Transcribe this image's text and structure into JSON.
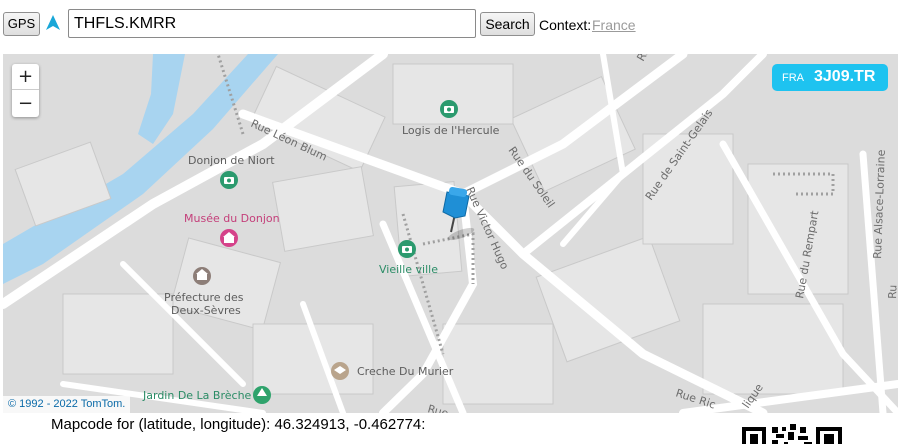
{
  "toolbar": {
    "gps_label": "GPS",
    "search_value": "THFLS.KMRR",
    "search_label": "Search",
    "context_label": "Context:",
    "context_value": "France"
  },
  "map": {
    "zoom_in": "+",
    "zoom_out": "−",
    "badge": {
      "context": "FRA",
      "code": "3J09.TR"
    },
    "copyright": "© 1992 - 2022 TomTom.",
    "streets": {
      "leon_blum": "Rue Léon Blum",
      "victor_hugo": "Rue Victor Hugo",
      "soleil": "Rue du Soleil",
      "saint_gelais": "Rue de Saint-Gelais",
      "rempart": "Rue du Rempart",
      "alsace_lorraine": "Rue Alsace-Lorraine",
      "ric": "Rue Ric",
      "ru_top": "Ru",
      "ru_right": "Ru",
      "rue_bottom": "Rue",
      "ique": "lique"
    },
    "pois": {
      "hercule": "Logis de l'Hercule",
      "donjon_niort": "Donjon de Niort",
      "musee_donjon": "Musée du Donjon",
      "vieille_ville": "Vieille ville",
      "prefecture_1": "Préfecture des",
      "prefecture_2": "Deux-Sèvres",
      "creche": "Creche Du Murier",
      "jardin": "Jardin De La Brèche"
    },
    "colors": {
      "river": "#a8d4f0",
      "badge": "#1ec3f0",
      "pin": "#1f8fd6"
    }
  },
  "caption": "Mapcode for (latitude, longitude): 46.324913, -0.462774:"
}
